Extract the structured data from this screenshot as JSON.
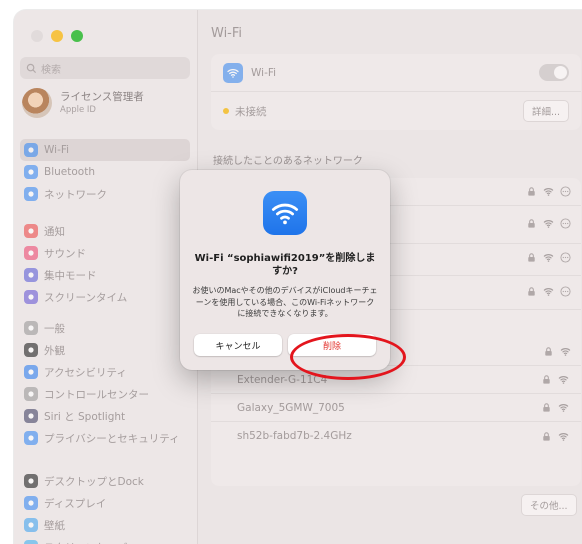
{
  "sidebar": {
    "search_placeholder": "検索",
    "account": {
      "name": "ライセンス管理者",
      "sub": "Apple ID"
    },
    "groups": [
      {
        "items": [
          {
            "label": "Wi-Fi",
            "icon": "wifi-icon",
            "color": "#3a8bf3",
            "active": true
          },
          {
            "label": "Bluetooth",
            "icon": "bluetooth-icon",
            "color": "#3a8bf3"
          },
          {
            "label": "ネットワーク",
            "icon": "globe-icon",
            "color": "#3a8bf3"
          }
        ]
      },
      {
        "items": [
          {
            "label": "通知",
            "icon": "bell-icon",
            "color": "#ee4b4b"
          },
          {
            "label": "サウンド",
            "icon": "speaker-icon",
            "color": "#ee4b74"
          },
          {
            "label": "集中モード",
            "icon": "moon-icon",
            "color": "#5f5fd8"
          },
          {
            "label": "スクリーンタイム",
            "icon": "hourglass-icon",
            "color": "#6a5ad6"
          }
        ]
      },
      {
        "items": [
          {
            "label": "一般",
            "icon": "gear-icon",
            "color": "#9a9a9a"
          },
          {
            "label": "外観",
            "icon": "appearance-icon",
            "color": "#222222"
          },
          {
            "label": "アクセシビリティ",
            "icon": "accessibility-icon",
            "color": "#2f7ff0"
          },
          {
            "label": "コントロールセンター",
            "icon": "control-center-icon",
            "color": "#9a9a9a"
          },
          {
            "label": "Siri と Spotlight",
            "icon": "siri-icon",
            "color": "#444466"
          },
          {
            "label": "プライバシーとセキュリティ",
            "icon": "hand-icon",
            "color": "#3a8bf3"
          }
        ]
      },
      {
        "items": [
          {
            "label": "デスクトップとDock",
            "icon": "dock-icon",
            "color": "#222222"
          },
          {
            "label": "ディスプレイ",
            "icon": "sun-icon",
            "color": "#3a8bf3"
          },
          {
            "label": "壁紙",
            "icon": "wallpaper-icon",
            "color": "#45a6f0"
          },
          {
            "label": "スクリーンセーバ",
            "icon": "screensaver-icon",
            "color": "#45b0f0"
          }
        ]
      }
    ]
  },
  "main": {
    "title": "Wi-Fi",
    "wifi_label": "Wi-Fi",
    "status": "未接続",
    "details_button": "詳細...",
    "known_networks_title": "接続したことのあるネットワーク",
    "networks": [
      {
        "name": "Extender-G-11C4"
      },
      {
        "name": "Galaxy_5GMW_7005"
      },
      {
        "name": "sh52b-fabd7b-2.4GHz"
      }
    ],
    "more_button": "その他..."
  },
  "dialog": {
    "title": "Wi-Fi “sophiawifi2019”を削除しますか?",
    "body": "お使いのMacやその他のデバイスがiCloudキーチェーンを使用している場合、このWi-Fiネットワークに接続できなくなります。",
    "cancel_label": "キャンセル",
    "delete_label": "削除",
    "accent_color": "#e3342f"
  }
}
